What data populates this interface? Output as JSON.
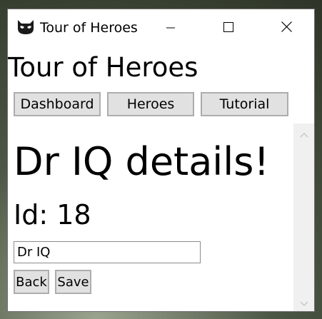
{
  "window": {
    "title": "Tour of Heroes",
    "icon": "masked-hero-icon",
    "controls": {
      "minimize": "minimize-icon",
      "maximize": "maximize-icon",
      "close": "close-icon"
    }
  },
  "app": {
    "header": "Tour of Heroes"
  },
  "nav": {
    "dashboard_label": "Dashboard",
    "heroes_label": "Heroes",
    "tutorial_label": "Tutorial"
  },
  "detail": {
    "title": "Dr IQ details!",
    "id_text": "Id: 18",
    "name_value": "Dr IQ"
  },
  "actions": {
    "back_label": "Back",
    "save_label": "Save"
  },
  "colors": {
    "button_bg": "#e1e1e1",
    "button_border": "#adadad",
    "scrollbar_track": "#f0f0f0"
  }
}
